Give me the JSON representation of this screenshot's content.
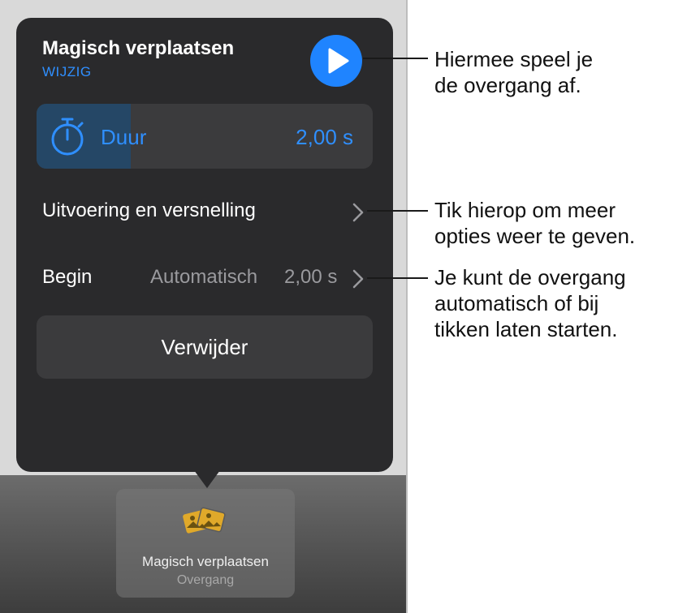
{
  "popover": {
    "title": "Magisch verplaatsen",
    "edit_label": "WIJZIG",
    "duration_label": "Duur",
    "duration_value": "2,00 s",
    "duration_fraction": 0.28,
    "speed_label": "Uitvoering en versnelling",
    "start_label": "Begin",
    "start_mode": "Automatisch",
    "start_delay": "2,00 s",
    "delete_label": "Verwijder"
  },
  "transition_tile": {
    "title": "Magisch verplaatsen",
    "subtitle": "Overgang"
  },
  "callouts": {
    "play": [
      "Hiermee speel je",
      "de overgang af."
    ],
    "options": [
      "Tik hierop om meer",
      "opties weer te geven."
    ],
    "start": [
      "Je kunt de overgang",
      "automatisch of bij",
      "tikken laten starten."
    ]
  },
  "colors": {
    "accent": "#1f84ff",
    "popover_bg": "#2a2a2c",
    "icon_gold": "#e0a92a"
  }
}
